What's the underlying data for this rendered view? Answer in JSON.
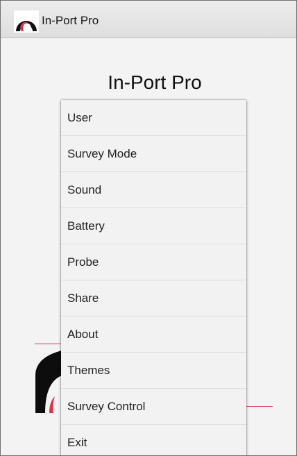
{
  "window": {
    "title": "In-Port Pro",
    "icon": "app-logo-icon"
  },
  "main": {
    "heading": "In-Port Pro"
  },
  "menu": {
    "items": [
      {
        "label": "User"
      },
      {
        "label": "Survey Mode"
      },
      {
        "label": "Sound"
      },
      {
        "label": "Battery"
      },
      {
        "label": "Probe"
      },
      {
        "label": "Share"
      },
      {
        "label": "About"
      },
      {
        "label": "Themes"
      },
      {
        "label": "Survey Control"
      },
      {
        "label": "Exit"
      }
    ]
  },
  "colors": {
    "accent": "#e0304a",
    "logo_dark": "#111111"
  }
}
